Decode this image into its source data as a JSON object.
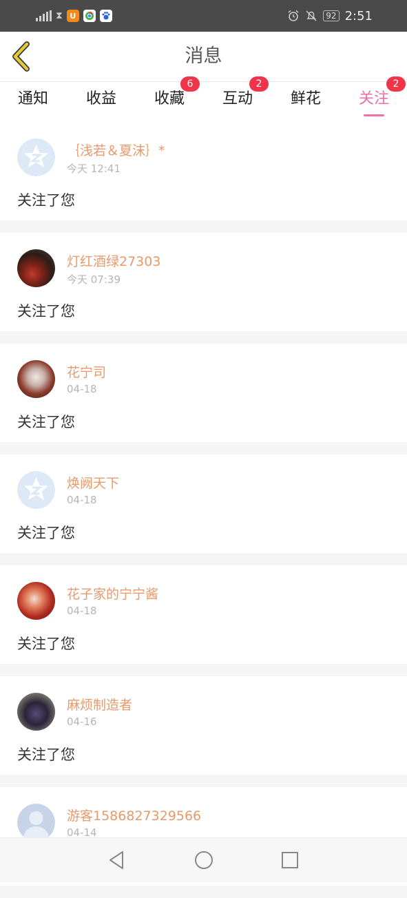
{
  "status_bar": {
    "time": "2:51",
    "battery": "92",
    "icons": [
      "signal-icon",
      "hourglass-icon",
      "uc-browser-icon",
      "chrome-icon",
      "baidu-icon",
      "alarm-icon",
      "bell-off-icon",
      "battery-icon"
    ]
  },
  "header": {
    "title": "消息",
    "back_icon": "chevron-left-icon",
    "accent": "#e3c93c"
  },
  "tabs": [
    {
      "label": "通知",
      "badge": null,
      "active": false
    },
    {
      "label": "收益",
      "badge": null,
      "active": false
    },
    {
      "label": "收藏",
      "badge": "6",
      "active": false
    },
    {
      "label": "互动",
      "badge": "2",
      "active": false
    },
    {
      "label": "鲜花",
      "badge": null,
      "active": false
    },
    {
      "label": "关注",
      "badge": "2",
      "active": true
    }
  ],
  "colors": {
    "active_tab": "#ef6fa6",
    "badge": "#f0354a",
    "username": "#e79a6b"
  },
  "messages": [
    {
      "username": "｛浅若＆夏沫｝*",
      "time": "今天 12:41",
      "action": "关注了您",
      "avatar": "default-avatar"
    },
    {
      "username": "灯红酒绿27303",
      "time": "今天 07:39",
      "action": "关注了您",
      "avatar": "photo-avatar-red"
    },
    {
      "username": "花宁司",
      "time": "04-18",
      "action": "关注了您",
      "avatar": "photo-avatar-anime"
    },
    {
      "username": "焕阙天下",
      "time": "04-18",
      "action": "关注了您",
      "avatar": "default-avatar"
    },
    {
      "username": "花子家的宁宁酱",
      "time": "04-18",
      "action": "关注了您",
      "avatar": "photo-avatar-anime-red"
    },
    {
      "username": "麻烦制造者",
      "time": "04-16",
      "action": "关注了您",
      "avatar": "photo-avatar-dark"
    },
    {
      "username": "游客1586827329566",
      "time": "04-14",
      "action": "",
      "avatar": "guest-avatar"
    }
  ],
  "nav_bar": {
    "buttons": [
      "back-triangle-icon",
      "home-circle-icon",
      "recents-square-icon"
    ]
  }
}
